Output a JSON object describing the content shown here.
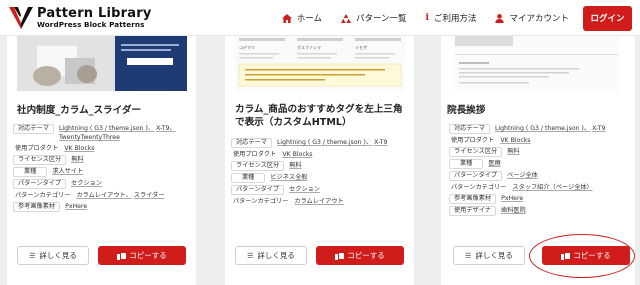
{
  "header": {
    "logo_title": "Pattern Library",
    "logo_sub": "WordPress Block Patterns",
    "nav": [
      {
        "icon": "home-icon",
        "label": "ホーム"
      },
      {
        "icon": "pattern-list-icon",
        "label": "パターン一覧"
      },
      {
        "icon": "info-icon",
        "label": "ご利用方法"
      },
      {
        "icon": "user-icon",
        "label": "マイアカウント"
      }
    ],
    "login_label": "ログイン"
  },
  "cards": [
    {
      "title": "社内制度_カラム_スライダー",
      "meta": [
        {
          "label": "対応テーマ",
          "values": [
            "Lightning ( G3 / theme.json )、",
            "X-T9、",
            "TwentyTwentyThree"
          ]
        },
        {
          "label": "使用プロダクト",
          "values": [
            "VK Blocks"
          ]
        },
        {
          "label": "ライセンス区分",
          "values": [
            "無料"
          ]
        },
        {
          "label": "業種",
          "values": [
            "求人サイト"
          ]
        },
        {
          "label": "パターンタイプ",
          "values": [
            "セクション"
          ]
        },
        {
          "label": "パターンカテゴリー",
          "values": [
            "カラムレイアウト、",
            "スライダー"
          ]
        },
        {
          "label": "参考画像素材",
          "values": [
            "PxHere"
          ]
        }
      ],
      "detail_label": "詳しく見る",
      "copy_label": "コピーする"
    },
    {
      "title": "カラム_商品のおすすめタグを左上三角で表示（カスタムHTML）",
      "meta": [
        {
          "label": "対応テーマ",
          "values": [
            "Lightning ( G3 / theme.json )、",
            "X-T9"
          ]
        },
        {
          "label": "使用プロダクト",
          "values": [
            "VK Blocks"
          ]
        },
        {
          "label": "ライセンス区分",
          "values": [
            "無料"
          ]
        },
        {
          "label": "業種",
          "values": [
            "ビジネス全般"
          ]
        },
        {
          "label": "パターンタイプ",
          "values": [
            "セクション"
          ]
        },
        {
          "label": "パターンカテゴリー",
          "values": [
            "カラムレイアウト"
          ]
        }
      ],
      "detail_label": "詳しく見る",
      "copy_label": "コピーする"
    },
    {
      "title": "院長挨拶",
      "meta": [
        {
          "label": "対応テーマ",
          "values": [
            "Lightning ( G3 / theme.json )、",
            "X-T9"
          ]
        },
        {
          "label": "使用プロダクト",
          "values": [
            "VK Blocks"
          ]
        },
        {
          "label": "ライセンス区分",
          "values": [
            "無料"
          ]
        },
        {
          "label": "業種",
          "values": [
            "医療"
          ]
        },
        {
          "label": "パターンタイプ",
          "values": [
            "ページ全体"
          ]
        },
        {
          "label": "パターンカテゴリー",
          "values": [
            "スタッフ紹介（ページ全体）"
          ]
        },
        {
          "label": "参考画像素材",
          "values": [
            "PxHere"
          ]
        },
        {
          "label": "使用デザイナ",
          "values": [
            "歯科医院"
          ]
        }
      ],
      "detail_label": "詳しく見る",
      "copy_label": "コピーする"
    }
  ],
  "thumb2_cols": [
    "コデマリ",
    "グルファシマ",
    "ミモザ"
  ],
  "colors": {
    "accent": "#d11c1c",
    "background": "#eeeeee"
  }
}
